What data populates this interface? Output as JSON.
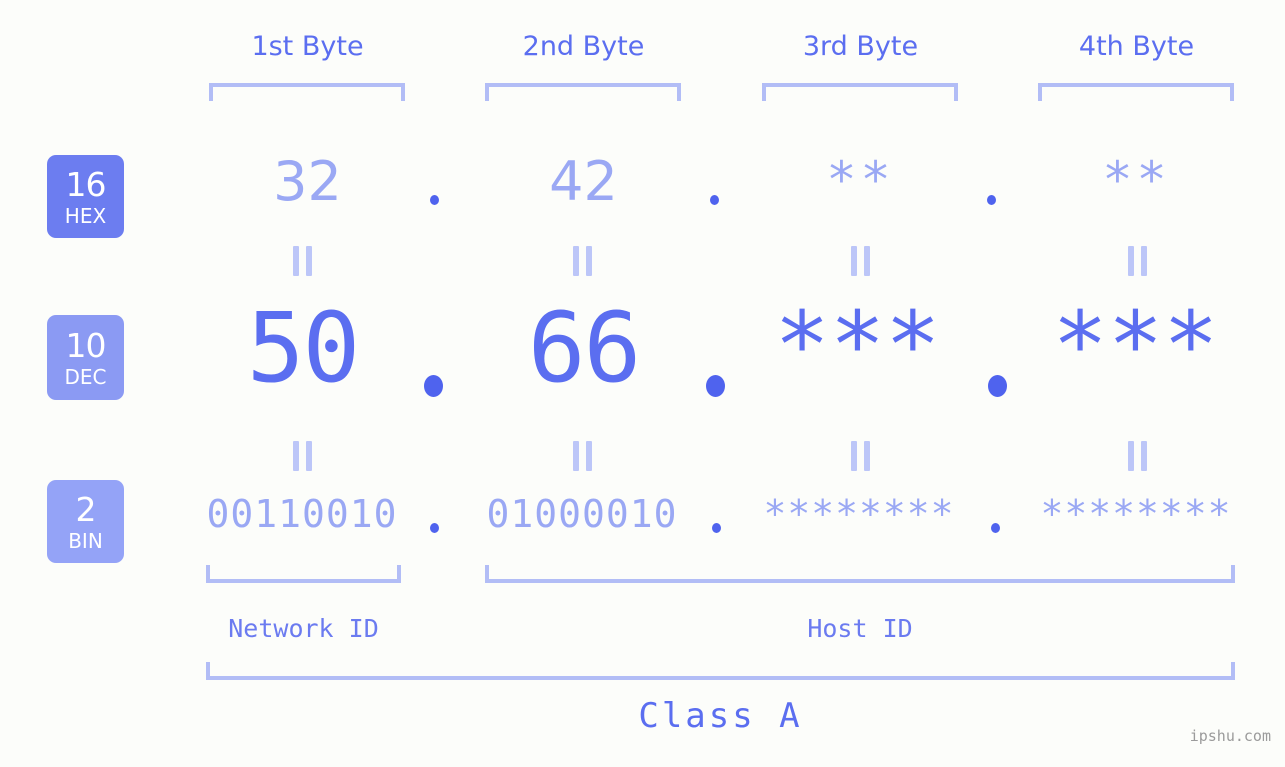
{
  "page": {
    "background_color": "#fcfdfa",
    "accent_color": "#5b6ef0",
    "accent_light_color": "#9aa8f4",
    "bracket_color": "#b2bdf6",
    "watermark": "ipshu.com"
  },
  "byte_headers": [
    {
      "label": "1st Byte"
    },
    {
      "label": "2nd Byte"
    },
    {
      "label": "3rd Byte"
    },
    {
      "label": "4th Byte"
    }
  ],
  "rows": [
    {
      "badge_number": "16",
      "badge_name": "HEX",
      "badge_color": "#6c7df0",
      "values": [
        "32",
        "42",
        "**",
        "**"
      ],
      "separator": "."
    },
    {
      "badge_number": "10",
      "badge_name": "DEC",
      "badge_color": "#8b9af3",
      "values": [
        "50",
        "66",
        "***",
        "***"
      ],
      "separator": "."
    },
    {
      "badge_number": "2",
      "badge_name": "BIN",
      "badge_color": "#94a3f7",
      "values": [
        "00110010",
        "01000010",
        "********",
        "********"
      ],
      "separator": "."
    }
  ],
  "equals_separator": "=",
  "footer": {
    "network_id_label": "Network ID",
    "host_id_label": "Host ID",
    "class_label": "Class A"
  }
}
